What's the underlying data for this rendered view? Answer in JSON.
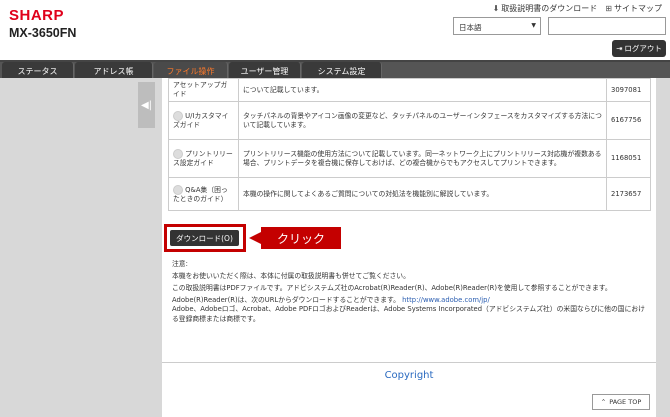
{
  "header": {
    "logo": "SHARP",
    "model": "MX-3650FN",
    "links": [
      {
        "icon": "download-icon",
        "label": "取扱説明書のダウンロード"
      },
      {
        "icon": "sitemap-icon",
        "label": "サイトマップ"
      }
    ],
    "language": "日本語",
    "search_value": "",
    "logout_label": "ログアウト"
  },
  "tabs": [
    {
      "label": "ステータス",
      "active": false
    },
    {
      "label": "アドレス帳",
      "active": false
    },
    {
      "label": "ファイル操作",
      "active": true
    },
    {
      "label": "ユーザー管理",
      "active": false
    },
    {
      "label": "システム設定",
      "active": false
    }
  ],
  "docs": [
    {
      "name": "アセットアップガイド",
      "desc": "について記載しています。",
      "size": "3097081"
    },
    {
      "name": "U/Iカスタマイズガイド",
      "desc": "タッチパネルの背景やアイコン画像の変更など、タッチパネルのユーザーインタフェースをカスタマイズする方法について記載しています。",
      "size": "6167756"
    },
    {
      "name": "プリントリリース設定ガイド",
      "desc": "プリントリリース機能の使用方法について記載しています。同一ネットワーク上にプリントリリース対応機が複数ある場合、プリントデータを複合機に保存しておけば、どの複合機からでもアクセスしてプリントできます。",
      "size": "1168051"
    },
    {
      "name": "Q&A集（困ったときのガイド）",
      "desc": "本機の操作に関してよくあるご質問についての対処法を機能別に解説しています。",
      "size": "2173657"
    }
  ],
  "download_button": "ダウンロード(O)",
  "callout": "クリック",
  "notes": {
    "title": "注意:",
    "lines": [
      "本機をお使いいただく際は、本体に付属の取扱説明書も併せてご覧ください。",
      "この取扱説明書はPDFファイルです。アドビシステムズ社のAcrobat(R)Reader(R)、Adobe(R)Reader(R)を使用して参照することができます。",
      "Adobe(R)Reader(R)は、次のURLからダウンロードすることができます。",
      "Adobe、Adobeロゴ、Acrobat、Adobe PDFロゴおよびReaderは、Adobe Systems Incorporated（アドビシステムズ社）の米国ならびに他の国における登録商標または商標です。"
    ],
    "url": "http://www.adobe.com/jp/"
  },
  "copyright": "Copyright",
  "page_top": "PAGE TOP"
}
